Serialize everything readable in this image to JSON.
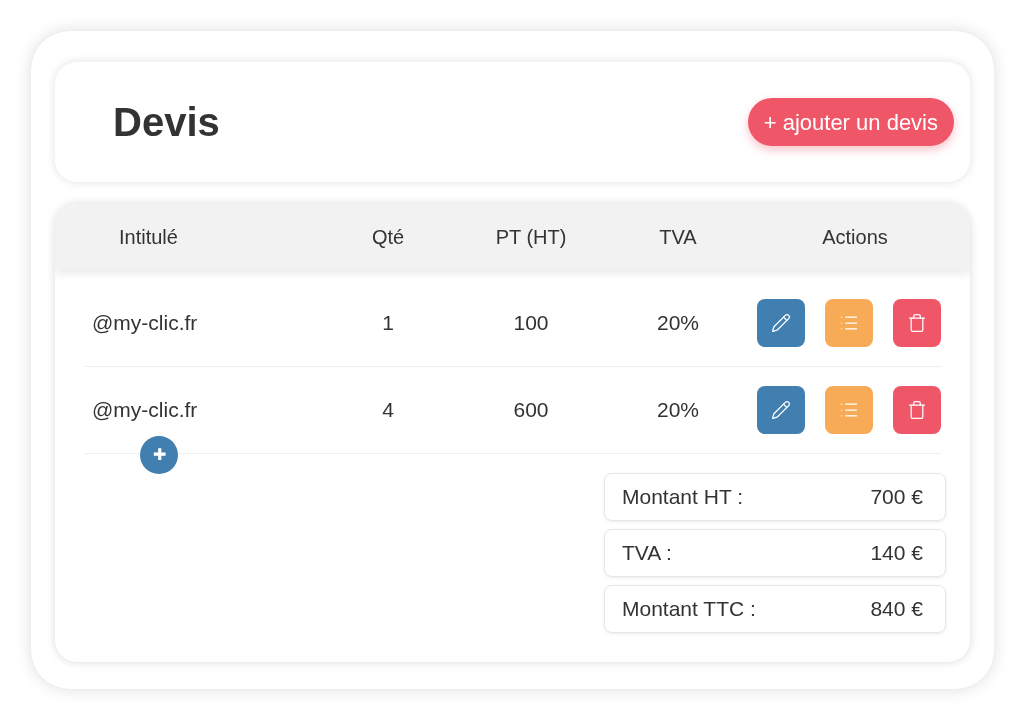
{
  "header": {
    "title": "Devis",
    "add_button": "+ ajouter un devis"
  },
  "table": {
    "columns": [
      "Intitulé",
      "Qté",
      "PT (HT)",
      "TVA",
      "Actions"
    ],
    "rows": [
      {
        "label": "@my-clic.fr",
        "qty": "1",
        "pt": "100",
        "tva": "20%"
      },
      {
        "label": "@my-clic.fr",
        "qty": "4",
        "pt": "600",
        "tva": "20%"
      }
    ],
    "add_row_button": "✚"
  },
  "totals": [
    {
      "label": "Montant HT :",
      "value": "700 €"
    },
    {
      "label": "TVA :",
      "value": "140 €"
    },
    {
      "label": "Montant TTC :",
      "value": "840 €"
    }
  ]
}
